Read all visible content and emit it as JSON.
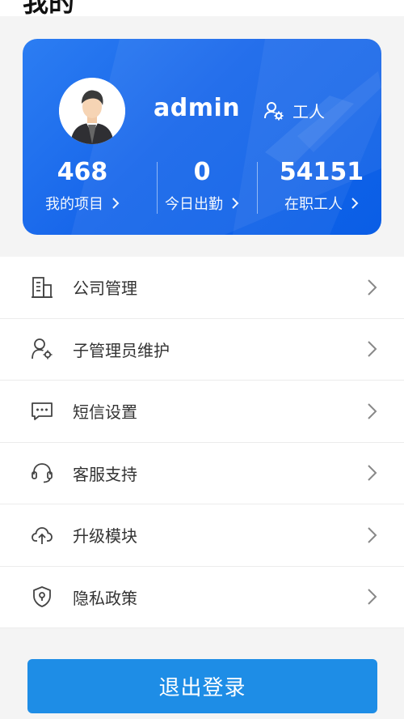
{
  "header": {
    "title": "我的"
  },
  "profile": {
    "username": "admin",
    "role_label": "工人",
    "stats": [
      {
        "value": "468",
        "label": "我的项目"
      },
      {
        "value": "0",
        "label": "今日出勤"
      },
      {
        "value": "54151",
        "label": "在职工人"
      }
    ]
  },
  "menu": {
    "items": [
      {
        "label": "公司管理",
        "icon": "building-icon"
      },
      {
        "label": "子管理员维护",
        "icon": "user-settings-icon"
      },
      {
        "label": "短信设置",
        "icon": "message-icon"
      },
      {
        "label": "客服支持",
        "icon": "headset-icon"
      },
      {
        "label": "升级模块",
        "icon": "cloud-upload-icon"
      },
      {
        "label": "隐私政策",
        "icon": "shield-icon"
      }
    ]
  },
  "logout": {
    "label": "退出登录"
  },
  "colors": {
    "card_blue": "#1766ea",
    "button_blue": "#1e8de6",
    "background": "#f4f4f4"
  }
}
